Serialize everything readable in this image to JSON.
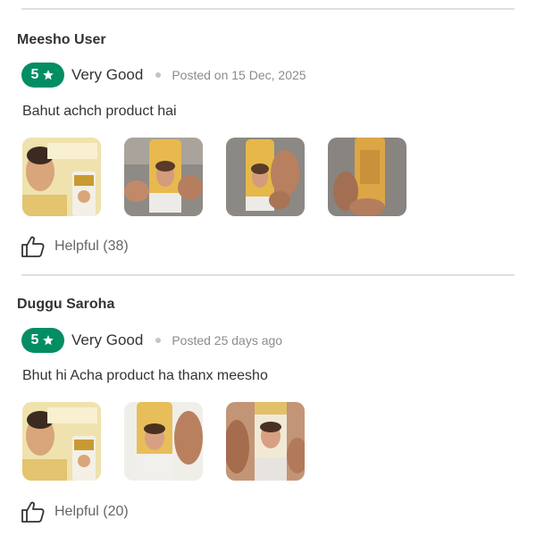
{
  "reviews": [
    {
      "user": "Meesho User",
      "rating": "5",
      "verdict": "Very Good",
      "posted": "Posted on 15 Dec, 2025",
      "comment": "Bahut achch product hai",
      "helpful": "Helpful (38)",
      "photos": [
        "product-box-photo",
        "tube-in-hand-photo",
        "tube-in-hand-photo",
        "tube-back-photo"
      ]
    },
    {
      "user": "Duggu Saroha",
      "rating": "5",
      "verdict": "Very Good",
      "posted": "Posted 25 days ago",
      "comment": "Bhut hi Acha product ha thanx meesho",
      "helpful": "Helpful (20)",
      "photos": [
        "product-box-photo",
        "tube-in-hand-photo",
        "tube-in-hand-photo"
      ]
    }
  ],
  "colors": {
    "rating_pill": "#038d63",
    "divider": "#dedede",
    "muted_text": "#8b8b8b"
  }
}
